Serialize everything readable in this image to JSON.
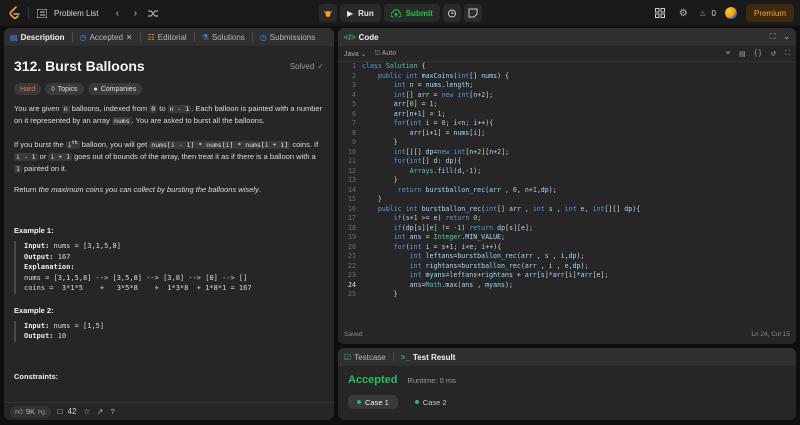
{
  "topbar": {
    "problem_list_label": "Problem List",
    "run_label": "Run",
    "submit_label": "Submit",
    "streak_count": "0",
    "premium_label": "Premium"
  },
  "left_tabs": [
    {
      "label": "Description"
    },
    {
      "label": "Accepted"
    },
    {
      "label": "Editorial"
    },
    {
      "label": "Solutions"
    },
    {
      "label": "Submissions"
    }
  ],
  "problem": {
    "title": "312. Burst Balloons",
    "status": "Solved",
    "difficulty": "Hard",
    "topics_label": "Topics",
    "companies_label": "Companies",
    "p1_a": "You are given ",
    "p1_n": "n",
    "p1_b": " balloons, indexed from ",
    "p1_0": "0",
    "p1_c": " to ",
    "p1_n1": "n - 1",
    "p1_d": ". Each balloon is painted with a number on it represented by an array ",
    "p1_nums": "nums",
    "p1_e": ". You are asked to burst all the balloons.",
    "p2_a": "If you burst the ",
    "p2_ith": "i",
    "p2_sup": "th",
    "p2_b": " balloon, you will get ",
    "p2_expr": "nums[i - 1] * nums[i] * nums[i + 1]",
    "p2_c": " coins. If ",
    "p2_im1": "i - 1",
    "p2_d": " or ",
    "p2_ip1": "i + 1",
    "p2_e": " goes out of bounds of the array, then treat it as if there is a balloon with a ",
    "p2_one": "1",
    "p2_f": " painted on it.",
    "p3_a": "Return ",
    "p3_em": "the maximum coins you can collect by bursting the balloons wisely",
    "p3_b": ".",
    "example1_title": "Example 1:",
    "ex1_input_k": "Input:",
    "ex1_input_v": " nums = [3,1,5,8]",
    "ex1_output_k": "Output:",
    "ex1_output_v": " 167",
    "ex1_expl_k": "Explanation:",
    "ex1_expl_1": "nums = [3,1,5,8] --> [3,5,8] --> [3,8] --> [8] --> []",
    "ex1_expl_2": "coins =  3*1*5    +   3*5*8    +  1*3*8  + 1*8*1 = 167",
    "example2_title": "Example 2:",
    "ex2_input_k": "Input:",
    "ex2_input_v": " nums = [1,5]",
    "ex2_output_k": "Output:",
    "ex2_output_v": " 10",
    "constraints_title": "Constraints:"
  },
  "left_footer": {
    "likes": "9K",
    "comments": "42"
  },
  "code_panel": {
    "title": "Code",
    "language": "Java",
    "auto_label": "Auto",
    "saved": "Saved",
    "cursor_pos": "Ln 24, Col 15",
    "current_line": 24
  },
  "code_lines": [
    "class Solution {",
    "    public int maxCoins(int[] nums) {",
    "        int n = nums.length;",
    "        int[] arr = new int[n+2];",
    "        arr[0] = 1;",
    "        arr[n+1] = 1;",
    "        for(int i = 0; i<n; i++){",
    "            arr[i+1] = nums[i];",
    "        }",
    "        int[][] dp=new int[n+2][n+2];",
    "        for(int[] d: dp){",
    "            Arrays.fill(d,-1);",
    "        }",
    "         return burstballon_rec(arr , 0, n+1,dp);",
    "    }",
    "    public int burstballon_rec(int[] arr , int s , int e, int[][] dp){",
    "        if(s+1 >= e) return 0;",
    "        if(dp[s][e] != -1) return dp[s][e];",
    "        int ans = Integer.MIN_VALUE;",
    "        for(int i = s+1; i<e; i++){",
    "            int leftans=burstballon_rec(arr , s , i,dp);",
    "            int rightans=burstballon_rec(arr , i , e,dp);",
    "            int myans=leftans+rightans + arr[s]*arr[i]*arr[e];",
    "            ans=Math.max(ans , myans);",
    "        }"
  ],
  "test_panel": {
    "tab_testcase": "Testcase",
    "tab_result": "Test Result",
    "result": "Accepted",
    "runtime": "Runtime: 0 ms",
    "cases": [
      "Case 1",
      "Case 2"
    ]
  },
  "colors": {
    "accent_orange": "#ffa116",
    "accepted_green": "#2cbb5d",
    "hard_red": "#f8615c"
  }
}
